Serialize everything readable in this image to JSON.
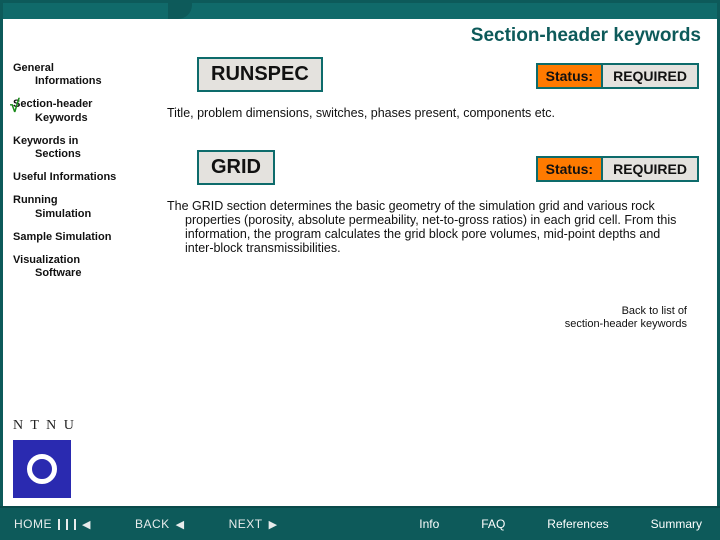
{
  "header": {
    "title": "Section-header keywords"
  },
  "sidebar": {
    "items": [
      {
        "line1": "General",
        "line2": "Informations"
      },
      {
        "line1": "Section-header",
        "line2": "Keywords"
      },
      {
        "line1": "Keywords in",
        "line2": "Sections"
      },
      {
        "line1": "Useful Informations",
        "line2": ""
      },
      {
        "line1": "Running",
        "line2": "Simulation"
      },
      {
        "line1": "Sample Simulation",
        "line2": ""
      },
      {
        "line1": "Visualization",
        "line2": "Software"
      }
    ],
    "logo_text": "N T N U"
  },
  "sections": [
    {
      "keyword": "RUNSPEC",
      "status_label": "Status:",
      "status_value": "REQUIRED",
      "description": "Title, problem dimensions, switches, phases present, components etc."
    },
    {
      "keyword": "GRID",
      "status_label": "Status:",
      "status_value": "REQUIRED",
      "description": "The GRID section determines the basic geometry of the simulation grid and various rock properties (porosity, absolute permeability, net-to-gross ratios) in each grid cell. From this information, the program calculates the grid block pore volumes, mid-point depths and inter-block transmissibilities."
    }
  ],
  "back_link": {
    "line1": "Back to list of",
    "line2": "section-header keywords"
  },
  "footer": {
    "nav": {
      "home": "HOME",
      "back": "BACK",
      "next": "NEXT"
    },
    "links": [
      "Info",
      "FAQ",
      "References",
      "Summary"
    ]
  }
}
